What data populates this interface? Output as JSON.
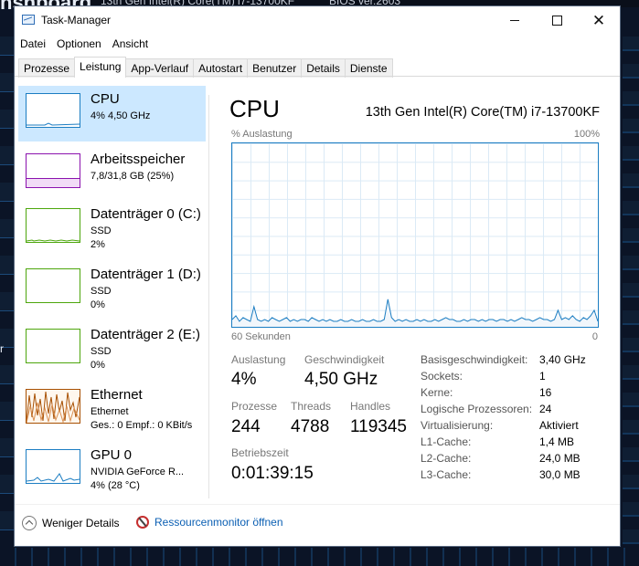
{
  "background": {
    "heading": "nshboard",
    "cpu_text": "13th Gen Intel(R) Core(TM) i7-13700KF",
    "bios_text": "BIOS ver.2603",
    "left_letter": "r"
  },
  "window": {
    "title": "Task-Manager",
    "icon": "taskmanager-icon"
  },
  "menu": [
    "Datei",
    "Optionen",
    "Ansicht"
  ],
  "tabs": [
    {
      "label": "Prozesse",
      "active": false
    },
    {
      "label": "Leistung",
      "active": true
    },
    {
      "label": "App-Verlauf",
      "active": false
    },
    {
      "label": "Autostart",
      "active": false
    },
    {
      "label": "Benutzer",
      "active": false
    },
    {
      "label": "Details",
      "active": false
    },
    {
      "label": "Dienste",
      "active": false
    }
  ],
  "sidebar": [
    {
      "name": "CPU",
      "sub1": "4%  4,50 GHz",
      "sub2": "",
      "color": "#1b7dc2"
    },
    {
      "name": "Arbeitsspeicher",
      "sub1": "7,8/31,8 GB (25%)",
      "sub2": "",
      "color": "#8b12ae"
    },
    {
      "name": "Datenträger 0 (C:)",
      "sub1": "SSD",
      "sub2": "2%",
      "color": "#4da60c"
    },
    {
      "name": "Datenträger 1 (D:)",
      "sub1": "SSD",
      "sub2": "0%",
      "color": "#4da60c"
    },
    {
      "name": "Datenträger 2 (E:)",
      "sub1": "SSD",
      "sub2": "0%",
      "color": "#4da60c"
    },
    {
      "name": "Ethernet",
      "sub1": "Ethernet",
      "sub2": "Ges.: 0  Empf.: 0 KBit/s",
      "color": "#a74f01"
    },
    {
      "name": "GPU 0",
      "sub1": "NVIDIA GeForce R...",
      "sub2": "4%  (28 °C)",
      "color": "#1b7dc2"
    }
  ],
  "main": {
    "title": "CPU",
    "model": "13th Gen Intel(R) Core(TM) i7-13700KF",
    "graph_label": "% Auslastung",
    "graph_max": "100%",
    "graph_time": "60 Sekunden",
    "graph_min": "0",
    "stats": {
      "util_label": "Auslastung",
      "util_value": "4%",
      "speed_label": "Geschwindigkeit",
      "speed_value": "4,50 GHz",
      "proc_label": "Prozesse",
      "proc_value": "244",
      "threads_label": "Threads",
      "threads_value": "4788",
      "handles_label": "Handles",
      "handles_value": "119345",
      "uptime_label": "Betriebszeit",
      "uptime_value": "0:01:39:15"
    },
    "properties": [
      {
        "label": "Basisgeschwindigkeit:",
        "value": "3,40 GHz"
      },
      {
        "label": "Sockets:",
        "value": "1"
      },
      {
        "label": "Kerne:",
        "value": "16"
      },
      {
        "label": "Logische Prozessoren:",
        "value": "24"
      },
      {
        "label": "Virtualisierung:",
        "value": "Aktiviert"
      },
      {
        "label": "L1-Cache:",
        "value": "1,4 MB"
      },
      {
        "label": "L2-Cache:",
        "value": "24,0 MB"
      },
      {
        "label": "L3-Cache:",
        "value": "30,0 MB"
      }
    ]
  },
  "footer": {
    "fewer_details": "Weniger Details",
    "resource_monitor": "Ressourcenmonitor öffnen"
  },
  "cpu_usage_history": [
    4,
    6,
    3,
    5,
    4,
    3,
    11,
    4,
    3,
    4,
    3,
    5,
    4,
    3,
    4,
    5,
    3,
    4,
    3,
    4,
    4,
    3,
    5,
    4,
    3,
    4,
    3,
    4,
    3,
    3,
    4,
    3,
    3,
    4,
    3,
    3,
    4,
    3,
    3,
    4,
    3,
    3,
    4,
    15,
    5,
    3,
    4,
    3,
    4,
    3,
    3,
    4,
    3,
    4,
    3,
    3,
    4,
    3,
    4,
    5,
    4,
    4,
    3,
    3,
    4,
    3,
    4,
    4,
    3,
    4,
    3,
    4,
    4,
    3,
    4,
    4,
    3,
    4,
    3,
    4,
    5,
    4,
    4,
    3,
    4,
    5,
    4,
    4,
    3,
    4,
    9,
    4,
    5,
    4,
    6,
    4,
    3,
    5,
    4,
    6,
    9,
    3
  ]
}
